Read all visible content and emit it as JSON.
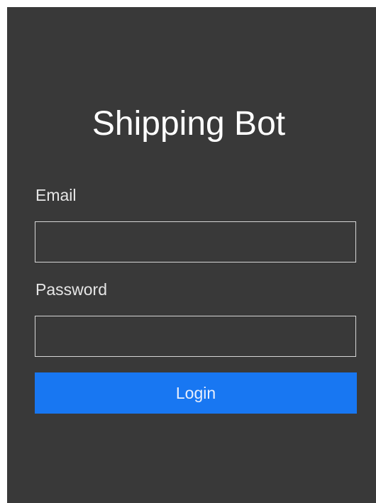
{
  "app": {
    "title": "Shipping Bot"
  },
  "form": {
    "email": {
      "label": "Email",
      "value": "",
      "placeholder": ""
    },
    "password": {
      "label": "Password",
      "value": "",
      "placeholder": ""
    },
    "login_label": "Login"
  },
  "colors": {
    "background": "#393939",
    "accent": "#1877f2",
    "text": "#ffffff",
    "input_border": "#d6d6d6"
  }
}
